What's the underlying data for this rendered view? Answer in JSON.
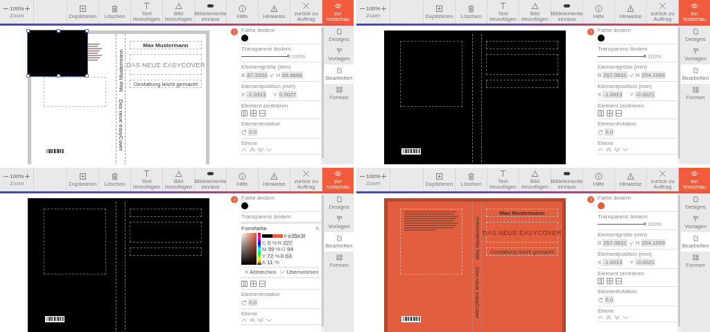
{
  "panels": [
    {
      "toolbar": {
        "zoom_value": "100%",
        "zoom_label": "Zoom",
        "items": [
          {
            "kind": "duplicate",
            "label": "Duplizieren"
          },
          {
            "kind": "delete",
            "label": "Löschen"
          },
          {
            "kind": "text",
            "label": "Text hinzufügen"
          },
          {
            "kind": "image",
            "label": "Bild hinzufügen"
          },
          {
            "kind": "toggle",
            "label": "Bildelemente ein/aus"
          },
          {
            "kind": "info",
            "label": "Hilfe"
          },
          {
            "kind": "warning",
            "label": "Hinweise"
          },
          {
            "kind": "close",
            "label": "zurück zu Auftrag"
          },
          {
            "kind": "preview",
            "label": "zur Vorschau"
          }
        ]
      },
      "cover": {
        "color": "#ffffff",
        "image_block": true,
        "back_text": true,
        "texts": {
          "author": "Max Mustermann",
          "title": "DAS NEUE EASYCOVER",
          "subtitle": "Gestaltung leicht gemacht",
          "spine_author": "Max Mustermann",
          "spine_title": "Das neue easyCover"
        }
      },
      "sections": [
        {
          "kind": "color",
          "label": "Farbe ändern",
          "color": "#000000"
        },
        {
          "kind": "transparency",
          "label": "Transparenz ändern",
          "level": 1,
          "reading": "100%"
        },
        {
          "kind": "pair",
          "label": "Elementgröße (mm)",
          "link": true,
          "fields": [
            {
              "prefix": "B",
              "value": "87.3333"
            },
            {
              "prefix": "H",
              "value": "66.6666"
            }
          ]
        },
        {
          "kind": "pair",
          "label": "Elementposition (mm)",
          "link": false,
          "fields": [
            {
              "prefix": "X",
              "value": "-1.0313"
            },
            {
              "prefix": "Y",
              "value": "0.0027"
            }
          ]
        },
        {
          "kind": "center",
          "label": "Element zentrieren"
        },
        {
          "kind": "rotation",
          "label": "Elementrotation",
          "value": "0,0"
        },
        {
          "kind": "layer",
          "label": "Ebene"
        }
      ],
      "tabs": [
        {
          "kind": "page",
          "label": "Designs",
          "selected": false
        },
        {
          "kind": "brush",
          "label": "Vorlagen",
          "selected": false
        },
        {
          "kind": "edit",
          "label": "Bearbeiten",
          "selected": true
        },
        {
          "kind": "shapes",
          "label": "Formen",
          "selected": false
        }
      ]
    },
    {
      "toolbar": {
        "zoom_value": "100%",
        "zoom_label": "Zoom",
        "items": [
          {
            "kind": "duplicate",
            "label": "Duplizieren"
          },
          {
            "kind": "delete",
            "label": "Löschen"
          },
          {
            "kind": "text",
            "label": "Text hinzufügen"
          },
          {
            "kind": "image",
            "label": "Bild hinzufügen"
          },
          {
            "kind": "toggle",
            "label": "Bildelemente ein/aus"
          },
          {
            "kind": "info",
            "label": "Hilfe"
          },
          {
            "kind": "warning",
            "label": "Hinweise"
          },
          {
            "kind": "close",
            "label": "zurück zu Auftrag"
          },
          {
            "kind": "preview",
            "label": "zur Vorschau"
          }
        ]
      },
      "cover": {
        "color": "#000000",
        "image_block": false,
        "back_text": false
      },
      "sections": [
        {
          "kind": "color",
          "label": "Farbe ändern",
          "color": "#000000"
        },
        {
          "kind": "transparency",
          "label": "Transparenz ändern",
          "level": 1,
          "reading": "100%"
        },
        {
          "kind": "pair",
          "label": "Elementgröße (mm)",
          "link": true,
          "fields": [
            {
              "prefix": "B",
              "value": "267.0631"
            },
            {
              "prefix": "H",
              "value": "204.1099"
            }
          ]
        },
        {
          "kind": "pair",
          "label": "Elementposition (mm)",
          "link": false,
          "fields": [
            {
              "prefix": "X",
              "value": "-1.0013"
            },
            {
              "prefix": "Y",
              "value": "-0.0021"
            }
          ]
        },
        {
          "kind": "center",
          "label": "Element zentrieren"
        },
        {
          "kind": "rotation",
          "label": "Elementrotation",
          "value": "0,0"
        },
        {
          "kind": "layer",
          "label": "Ebene"
        }
      ],
      "tabs": [
        {
          "kind": "page",
          "label": "Designs",
          "selected": false
        },
        {
          "kind": "brush",
          "label": "Vorlagen",
          "selected": false
        },
        {
          "kind": "edit",
          "label": "Bearbeiten",
          "selected": true
        },
        {
          "kind": "shapes",
          "label": "Formen",
          "selected": false
        }
      ]
    },
    {
      "toolbar": {
        "zoom_value": "100%",
        "zoom_label": "Zoom",
        "items": [
          {
            "kind": "duplicate",
            "label": "Duplizieren"
          },
          {
            "kind": "delete",
            "label": "Löschen"
          },
          {
            "kind": "text",
            "label": "Text hinzufügen"
          },
          {
            "kind": "image",
            "label": "Bild hinzufügen"
          },
          {
            "kind": "toggle",
            "label": "Bildelemente ein/aus"
          },
          {
            "kind": "info",
            "label": "Hilfe"
          },
          {
            "kind": "warning",
            "label": "Hinweise"
          },
          {
            "kind": "close",
            "label": "zurück zu Auftrag"
          },
          {
            "kind": "preview",
            "label": "zur Vorschau"
          }
        ]
      },
      "cover": {
        "color": "#000000",
        "image_block": false,
        "back_text": false
      },
      "sections": [
        {
          "kind": "color",
          "label": "Farbe ändern",
          "color": "#000000"
        },
        {
          "kind": "heading",
          "label": "Transparenz ändern"
        },
        {
          "kind": "picker",
          "title": "Formfarbe",
          "hex_label": "#",
          "hex": "e35e3f",
          "cmyk": [
            {
              "name": "C",
              "value": "0"
            },
            {
              "name": "M",
              "value": "59"
            },
            {
              "name": "Y",
              "value": "72"
            },
            {
              "name": "K",
              "value": "11"
            }
          ],
          "unit": "%",
          "rgb": [
            {
              "name": "R",
              "value": "227"
            },
            {
              "name": "G",
              "value": "94"
            },
            {
              "name": "B",
              "value": "63"
            }
          ],
          "cancel": "Abbrechen",
          "apply": "Übernehmen"
        },
        {
          "kind": "center"
        },
        {
          "kind": "rotation",
          "label": "Elementrotation",
          "value": "0,0"
        },
        {
          "kind": "layer",
          "label": "Ebene"
        }
      ],
      "tabs": [
        {
          "kind": "page",
          "label": "Designs",
          "selected": false
        },
        {
          "kind": "brush",
          "label": "Vorlagen",
          "selected": false
        },
        {
          "kind": "edit",
          "label": "Bearbeiten",
          "selected": true
        },
        {
          "kind": "shapes",
          "label": "Formen",
          "selected": false
        }
      ]
    },
    {
      "toolbar": {
        "zoom_value": "100%",
        "zoom_label": "Zoom",
        "items": [
          {
            "kind": "duplicate",
            "label": "Duplizieren"
          },
          {
            "kind": "delete",
            "label": "Löschen"
          },
          {
            "kind": "text",
            "label": "Text hinzufügen"
          },
          {
            "kind": "image",
            "label": "Bild hinzufügen"
          },
          {
            "kind": "toggle",
            "label": "Bildelemente ein/aus"
          },
          {
            "kind": "info",
            "label": "Hilfe"
          },
          {
            "kind": "warning",
            "label": "Hinweise"
          },
          {
            "kind": "close",
            "label": "zurück zu Auftrag"
          },
          {
            "kind": "preview",
            "label": "zur Vorschau"
          }
        ]
      },
      "cover": {
        "color": "#e35e3f",
        "image_block": false,
        "back_text": true,
        "texts": {
          "author": "Max Mustermann",
          "title": "DAS NEUE EASYCOVER",
          "subtitle": "Gestaltung leicht gemacht",
          "spine_author": "Max Mustermann",
          "spine_title": "Das neue easyCover"
        }
      },
      "sections": [
        {
          "kind": "color",
          "label": "Farbe ändern",
          "color": "#e35e3f"
        },
        {
          "kind": "transparency",
          "label": "Transparenz ändern",
          "level": 1,
          "reading": "100%"
        },
        {
          "kind": "pair",
          "label": "Elementgröße (mm)",
          "link": true,
          "fields": [
            {
              "prefix": "B",
              "value": "267.0631"
            },
            {
              "prefix": "H",
              "value": "204.1099"
            }
          ]
        },
        {
          "kind": "pair",
          "label": "Elementposition (mm)",
          "link": false,
          "fields": [
            {
              "prefix": "X",
              "value": "-1.0013"
            },
            {
              "prefix": "Y",
              "value": "-0.0021"
            }
          ]
        },
        {
          "kind": "center",
          "label": "Element zentrieren"
        },
        {
          "kind": "rotation",
          "label": "Elementrotation",
          "value": "0,0"
        },
        {
          "kind": "layer",
          "label": "Ebene"
        }
      ],
      "tabs": [
        {
          "kind": "page",
          "label": "Designs",
          "selected": false
        },
        {
          "kind": "brush",
          "label": "Vorlagen",
          "selected": false
        },
        {
          "kind": "edit",
          "label": "Bearbeiten",
          "selected": true
        },
        {
          "kind": "shapes",
          "label": "Formen",
          "selected": false
        }
      ]
    }
  ]
}
